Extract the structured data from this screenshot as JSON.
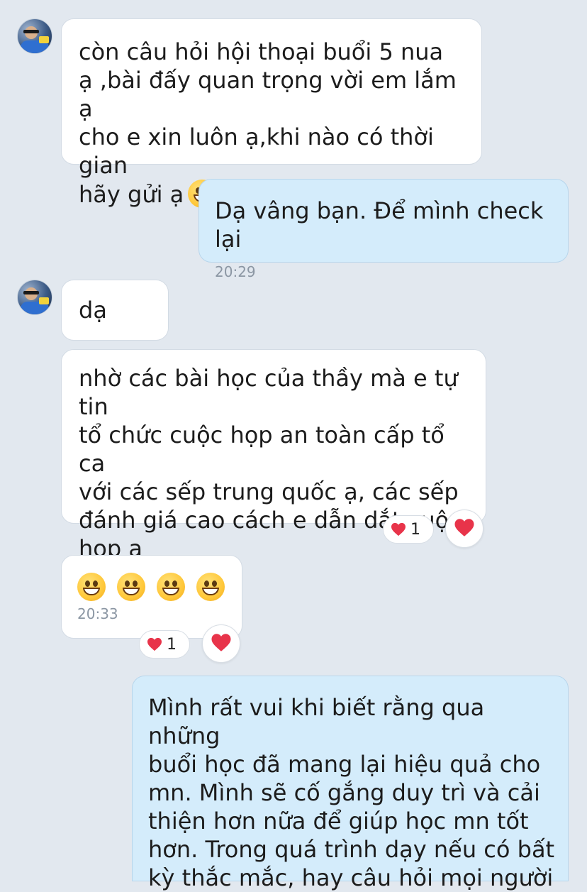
{
  "colors": {
    "background": "#e2e8ef",
    "incoming_bubble": "#ffffff",
    "outgoing_bubble": "#d4ecfb",
    "timestamp": "#8b96a3",
    "heart": "#e8344a"
  },
  "messages": [
    {
      "direction": "incoming",
      "text": "còn câu hỏi hội thoại buổi 5   nua\nạ ,bài đấy quan trọng vời em lắm ạ\ncho e xin luôn ạ,khi nào có thời gian\nhãy gửi ạ",
      "trailing_emoji": "grinning-face",
      "trailing_emoji_count": 6
    },
    {
      "direction": "outgoing",
      "text": "Dạ vâng bạn. Để mình check lại",
      "time": "20:29"
    },
    {
      "direction": "incoming",
      "text": "dạ"
    },
    {
      "direction": "incoming",
      "text": "nhờ các bài học của thầy mà e tự tin\ntổ chức cuộc họp an toàn cấp tổ ca\nvới các sếp trung quốc ạ, các sếp\nđánh giá cao cách e dẫn dắt cuộc\nhọp ạ",
      "reaction": {
        "icon": "heart-icon",
        "count": "1"
      }
    },
    {
      "direction": "incoming",
      "emoji": "grinning-face",
      "emoji_count": 4,
      "time": "20:33",
      "reaction": {
        "icon": "heart-icon",
        "count": "1"
      }
    },
    {
      "direction": "outgoing",
      "text": "Mình rất vui khi biết rằng qua những\nbuổi học đã mang lại hiệu quả cho\nmn. Mình sẽ cố gắng duy trì và cải\nthiện hơn nữa để giúp học mn tốt\nhơn. Trong quá trình dạy nếu có bất\nkỳ thắc mắc, hay câu hỏi mọi người"
    }
  ]
}
